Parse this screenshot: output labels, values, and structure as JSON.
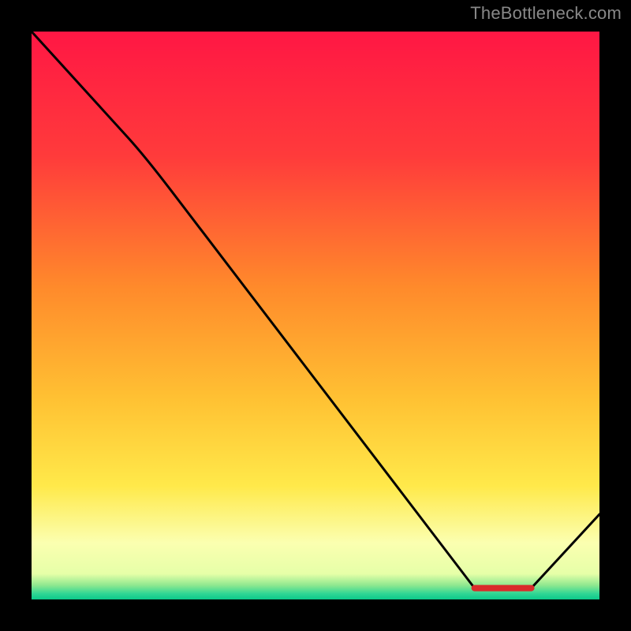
{
  "watermark": "TheBottleneck.com",
  "chart_data": {
    "type": "line",
    "title": "",
    "xlabel": "",
    "ylabel": "",
    "xlim": [
      0,
      100
    ],
    "ylim": [
      0,
      100
    ],
    "grid": false,
    "series": [
      {
        "name": "curve",
        "x": [
          0,
          20,
          78,
          88,
          100
        ],
        "y": [
          100,
          78,
          2,
          2,
          15
        ]
      }
    ],
    "gradient_stops": [
      {
        "pos": 0.0,
        "color": "#ff1744"
      },
      {
        "pos": 0.22,
        "color": "#ff3b3b"
      },
      {
        "pos": 0.45,
        "color": "#ff8a2b"
      },
      {
        "pos": 0.65,
        "color": "#ffc233"
      },
      {
        "pos": 0.8,
        "color": "#ffe94a"
      },
      {
        "pos": 0.9,
        "color": "#fbffb0"
      },
      {
        "pos": 0.955,
        "color": "#e6ffa8"
      },
      {
        "pos": 0.975,
        "color": "#8fe88f"
      },
      {
        "pos": 0.99,
        "color": "#2fd694"
      },
      {
        "pos": 1.0,
        "color": "#0cc98a"
      }
    ],
    "flat_segment": {
      "x_start": 78,
      "x_end": 88,
      "y": 2,
      "color": "#d92b2b",
      "thickness": 8
    }
  }
}
